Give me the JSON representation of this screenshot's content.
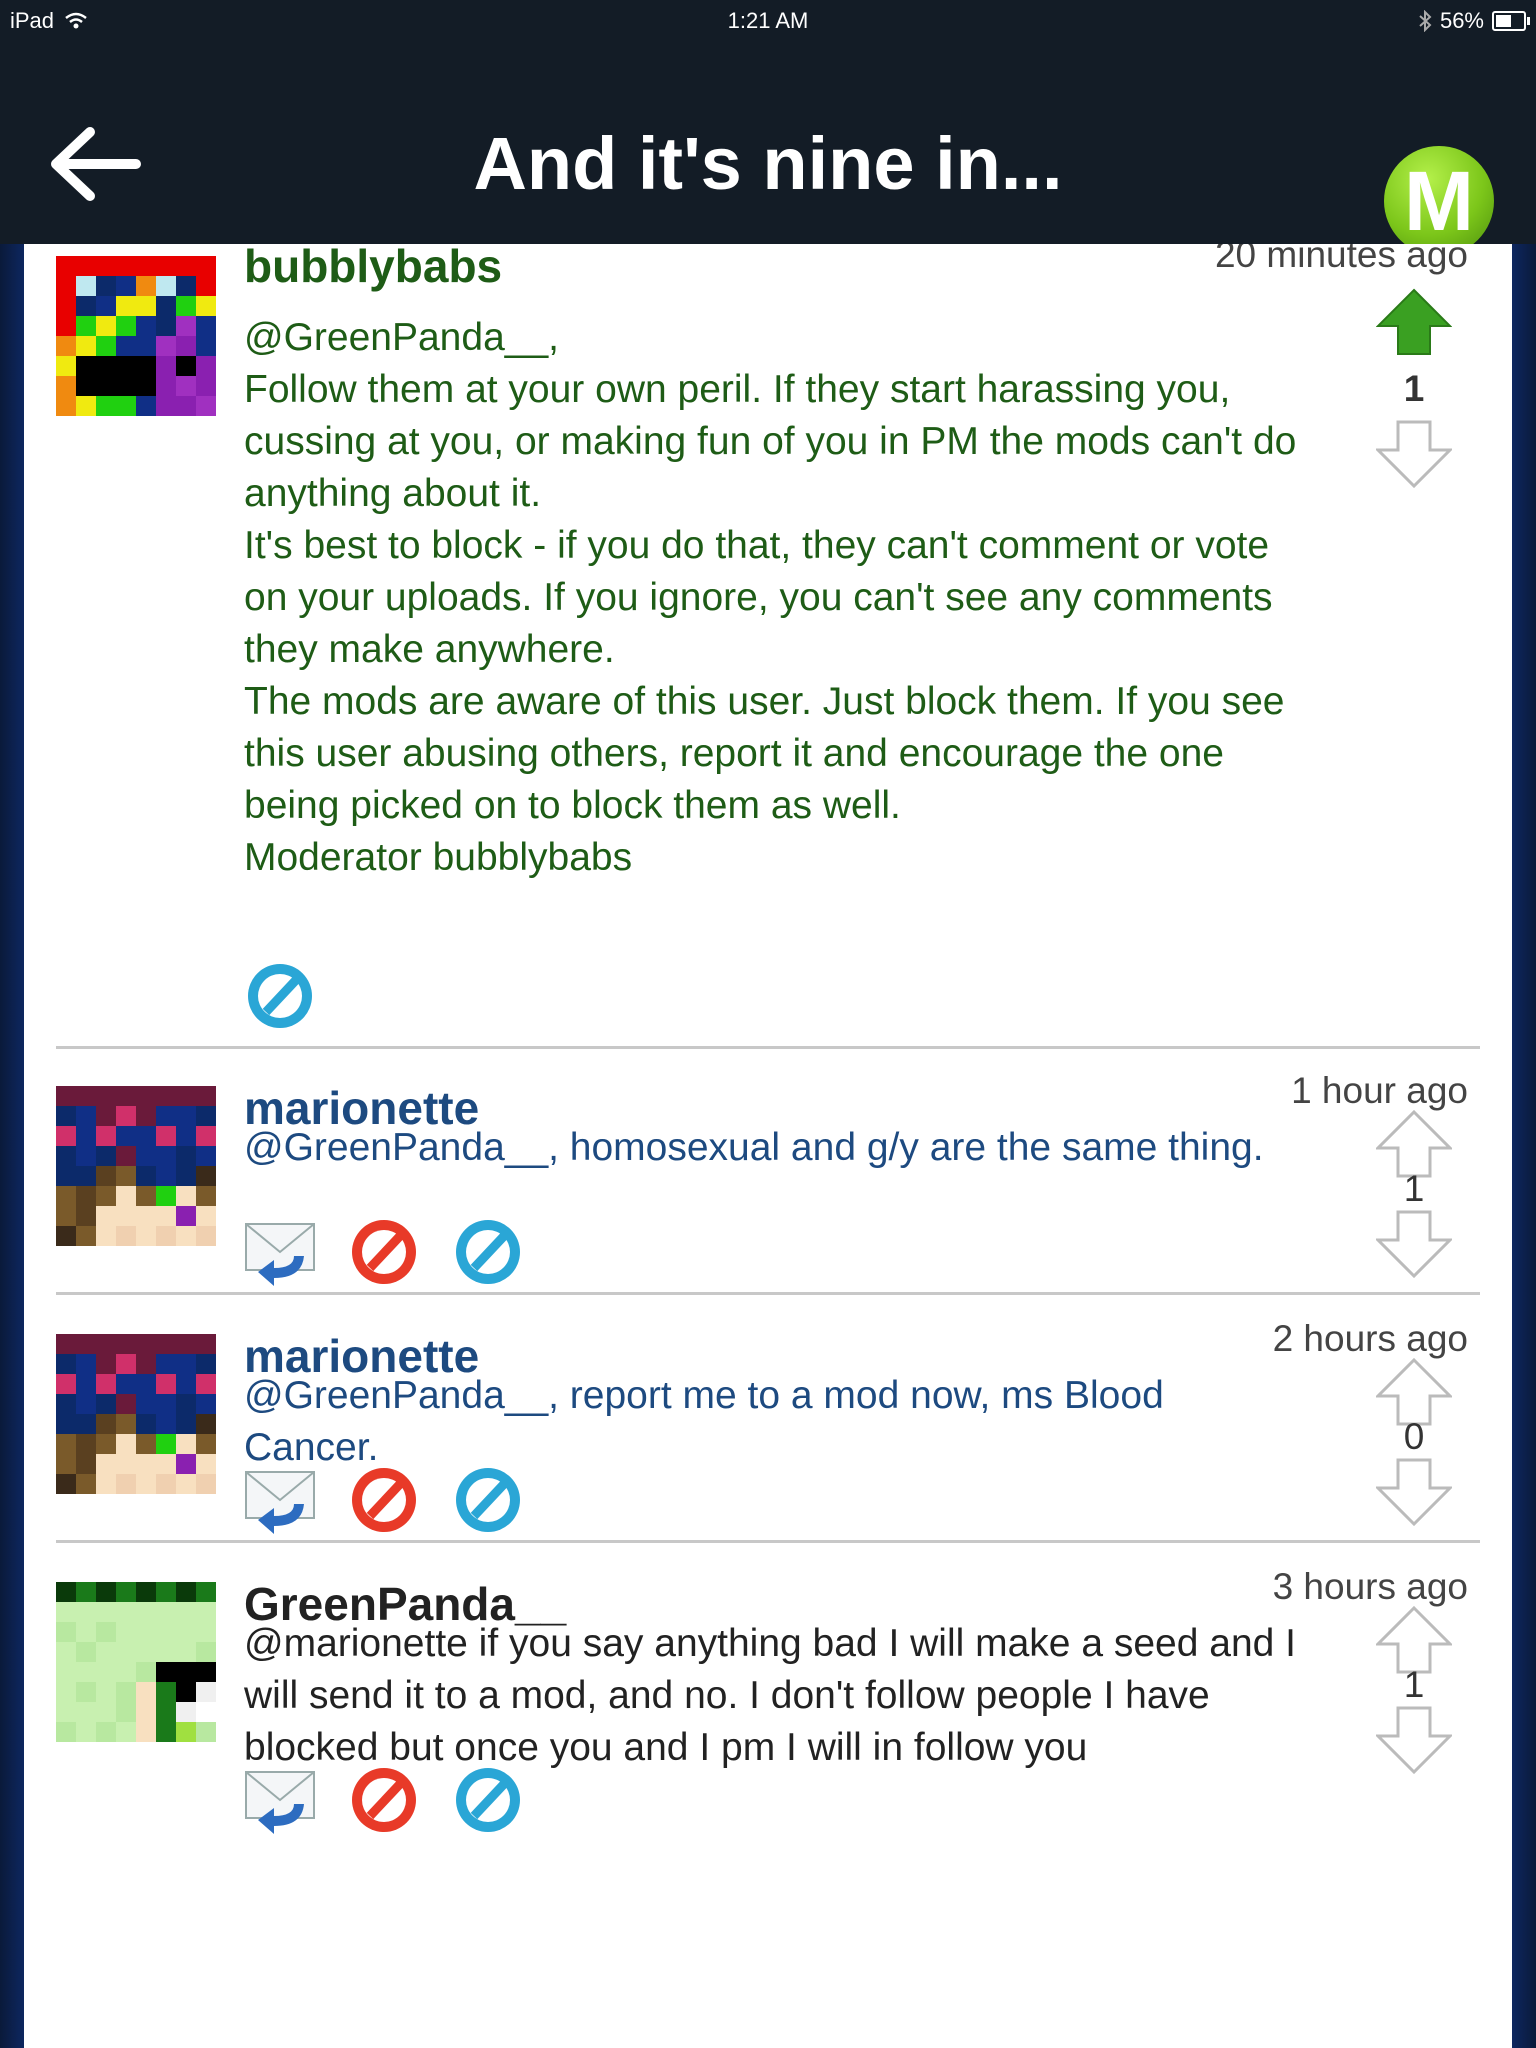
{
  "status_bar": {
    "device": "iPad",
    "time": "1:21 AM",
    "battery": "56%",
    "battery_level": 0.56
  },
  "nav": {
    "title": "And it's nine in...",
    "logo_letter": "M"
  },
  "colors": {
    "moderator_text": "#1e5c16",
    "user_text": "#1d4a80",
    "author_text": "#222222",
    "vote_active": "#3aa022"
  },
  "comments": [
    {
      "username": "bubblybabs",
      "time": "20 minutes ago",
      "lines": [
        "@GreenPanda__,",
        "Follow them at your own peril. If they start harassing you, cussing at you, or making fun of you in PM the mods can't do anything about it.",
        "It's best to block - if you do that, they can't comment or vote on your uploads. If you ignore, you can't see any comments they make anywhere.",
        "The mods are aware of this user. Just block them. If you see this user abusing others, report it and encourage the one being picked on to block them as well.",
        "Moderator bubblybabs"
      ],
      "votes": "1",
      "upvoted": true,
      "actions": [
        "ignore-icon"
      ]
    },
    {
      "username": "marionette",
      "time": "1 hour ago",
      "lines": [
        "@GreenPanda__, homosexual and g/y are the same thing."
      ],
      "votes": "1",
      "upvoted": false,
      "actions": [
        "reply-mail-icon",
        "block-icon",
        "ignore-icon"
      ]
    },
    {
      "username": "marionette",
      "time": "2 hours ago",
      "lines": [
        "@GreenPanda__, report me to a mod now, ms Blood Cancer."
      ],
      "votes": "0",
      "upvoted": false,
      "actions": [
        "reply-mail-icon",
        "block-icon",
        "ignore-icon"
      ]
    },
    {
      "username": "GreenPanda__",
      "time": "3 hours ago",
      "lines": [
        "@marionette if you say anything bad I will make a seed and I will send it to a mod, and no. I don't follow people I have blocked but once you and I pm I will in follow you"
      ],
      "votes": "1",
      "upvoted": false,
      "actions": [
        "reply-mail-icon",
        "block-icon",
        "ignore-icon"
      ]
    }
  ]
}
